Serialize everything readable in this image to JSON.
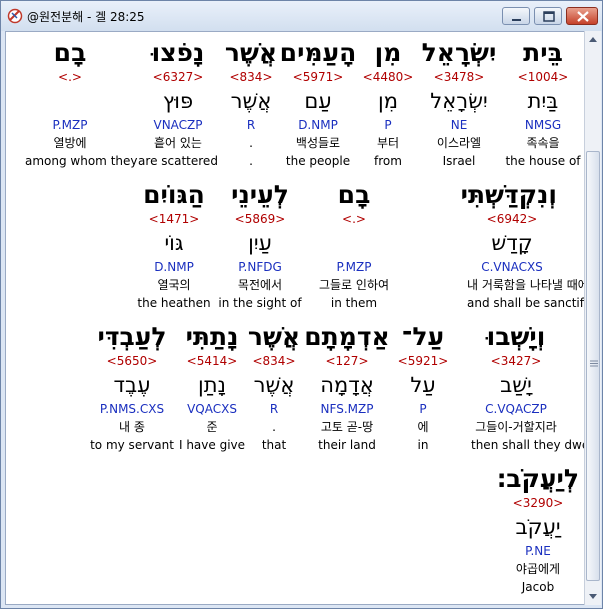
{
  "window": {
    "title": "@원전분해 - 겔 28:25"
  },
  "rows": [
    [
      {
        "heb": "בֵּית",
        "num": "<1004>",
        "lex": "בַּיִת",
        "morph": "NMSG",
        "kor": "족속을",
        "eng": "the house of"
      },
      {
        "heb": "יִשְׂרָאֵל",
        "num": "<3478>",
        "lex": "יִשְׂרָאֵל",
        "morph": "NE",
        "kor": "이스라엘",
        "eng": "Israel"
      },
      {
        "heb": "מִן",
        "num": "<4480>",
        "lex": "מִן",
        "morph": "P",
        "kor": "부터",
        "eng": "from"
      },
      {
        "heb": "הָעַמִּים",
        "num": "<5971>",
        "lex": "עַם",
        "morph": "D.NMP",
        "kor": "백성들로",
        "eng": "the people"
      },
      {
        "heb": "אֲשֶׁר",
        "num": "<834>",
        "lex": "אֲשֶׁר",
        "morph": "R",
        "kor": ".",
        "eng": "."
      },
      {
        "heb": "נָפֹצוּ",
        "num": "<6327>",
        "lex": "פּוּץ",
        "morph": "VNACZP",
        "kor": "흩어 있는",
        "eng": "are scattered"
      },
      {
        "heb": "בָם",
        "num": "<.>",
        "lex": "",
        "morph": "P.MZP",
        "kor": "열방에",
        "eng": "among whom they"
      }
    ],
    [
      {
        "heb": "וְנִקְדַּשְׁתִּי",
        "num": "<6942>",
        "lex": "קָדַשׁ",
        "morph": "C.VNACXS",
        "kor": "내 거룩함을 나타낼 때에",
        "eng": "and shall be sanctified"
      },
      {
        "heb": "בָם",
        "num": "<.>",
        "lex": "",
        "morph": "P.MZP",
        "kor": "그들로 인하여",
        "eng": "in them"
      },
      {
        "heb": "לְעֵינֵי",
        "num": "<5869>",
        "lex": "עַיִן",
        "morph": "P.NFDG",
        "kor": "목전에서",
        "eng": "in the sight of"
      },
      {
        "heb": "הַגּוֹיִם",
        "num": "<1471>",
        "lex": "גּוֹי",
        "morph": "D.NMP",
        "kor": "열국의",
        "eng": "the heathen"
      }
    ],
    [
      {
        "heb": "וְיָשְׁבוּ",
        "num": "<3427>",
        "lex": "יָשַׁב",
        "morph": "C.VQACZP",
        "kor": "그들이-거할지라",
        "eng": "then shall they dwell"
      },
      {
        "heb": "עַל־",
        "num": "<5921>",
        "lex": "עַל",
        "morph": "P",
        "kor": "에",
        "eng": "in"
      },
      {
        "heb": "אַדְמָתָם",
        "num": "<127>",
        "lex": "אֲדָמָה",
        "morph": "NFS.MZP",
        "kor": "고토 곧-땅",
        "eng": "their land"
      },
      {
        "heb": "אֲשֶׁר",
        "num": "<834>",
        "lex": "אֲשֶׁר",
        "morph": "R",
        "kor": ".",
        "eng": "that"
      },
      {
        "heb": "נָתַתִּי",
        "num": "<5414>",
        "lex": "נָתַן",
        "morph": "VQACXS",
        "kor": "준",
        "eng": "I have give"
      },
      {
        "heb": "לְעַבְדִּי",
        "num": "<5650>",
        "lex": "עֶבֶד",
        "morph": "P.NMS.CXS",
        "kor": "내 종",
        "eng": "to my servant"
      }
    ],
    [
      {
        "heb": "לְיַעֲקֹב׃",
        "num": "<3290>",
        "lex": "יַעֲקֹב",
        "morph": "P.NE",
        "kor": "야곱에게",
        "eng": "Jacob"
      }
    ]
  ]
}
